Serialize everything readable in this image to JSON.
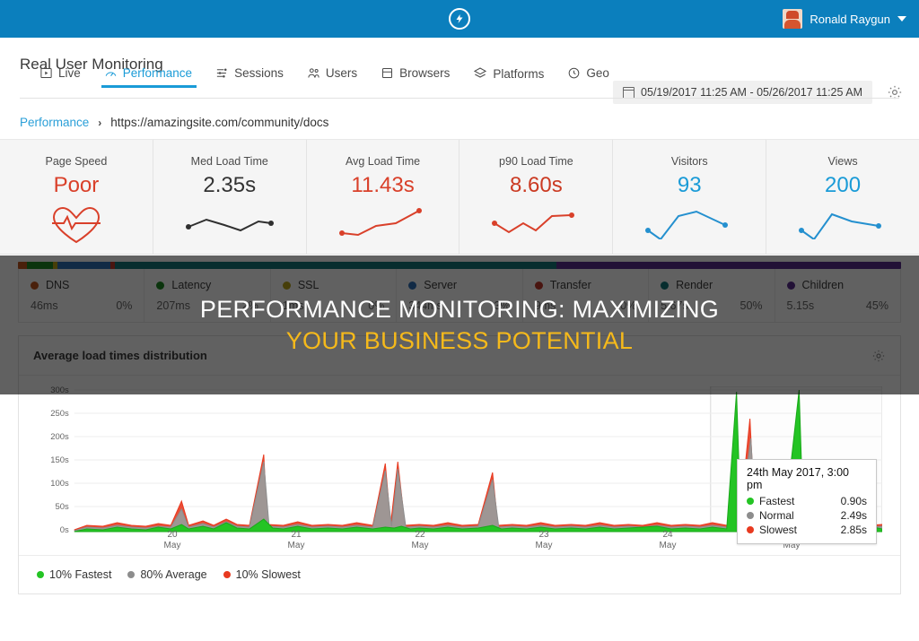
{
  "topbar": {
    "logo_icon": "lightning-bolt-icon",
    "user_name": "Ronald Raygun",
    "caret_icon": "chevron-down-icon"
  },
  "header": {
    "title": "Real User Monitoring",
    "date_range": "05/19/2017 11:25 AM - 05/26/2017 11:25 AM",
    "calendar_icon": "calendar-icon",
    "settings_icon": "gear-icon"
  },
  "nav": {
    "items": [
      {
        "label": "Live",
        "icon": "play-box-icon",
        "active": false
      },
      {
        "label": "Performance",
        "icon": "speedometer-icon",
        "active": true
      },
      {
        "label": "Sessions",
        "icon": "sessions-list-icon",
        "active": false
      },
      {
        "label": "Users",
        "icon": "users-icon",
        "active": false
      },
      {
        "label": "Browsers",
        "icon": "browser-window-icon",
        "active": false
      },
      {
        "label": "Platforms",
        "icon": "layers-icon",
        "active": false
      },
      {
        "label": "Geo",
        "icon": "globe-clock-icon",
        "active": false
      }
    ]
  },
  "breadcrumb": {
    "root": "Performance",
    "separator": "›",
    "current": "https://amazingsite.com/community/docs"
  },
  "metrics": [
    {
      "label": "Page Speed",
      "value": "Poor",
      "color": "#d9402a",
      "spark": "heart-pulse-icon"
    },
    {
      "label": "Med Load Time",
      "value": "2.35s",
      "color": "#333333",
      "spark": "sparkline-dark"
    },
    {
      "label": "Avg Load Time",
      "value": "11.43s",
      "color": "#d9402a",
      "spark": "sparkline-red"
    },
    {
      "label": "p90 Load Time",
      "value": "8.60s",
      "color": "#cb3a22",
      "spark": "sparkline-red"
    },
    {
      "label": "Visitors",
      "value": "93",
      "color": "#1a9bd7",
      "spark": "sparkline-blue"
    },
    {
      "label": "Views",
      "value": "200",
      "color": "#1a9bd7",
      "spark": "sparkline-blue"
    }
  ],
  "breakdown": {
    "segments": [
      {
        "name": "DNS",
        "color": "#c1541f",
        "pct_width": 1
      },
      {
        "name": "Latency",
        "color": "#1e8a24",
        "pct_width": 3
      },
      {
        "name": "SSL",
        "color": "#b8a31a",
        "pct_width": 0.4
      },
      {
        "name": "Server",
        "color": "#2d6fb5",
        "pct_width": 6
      },
      {
        "name": "Transfer",
        "color": "#c0392b",
        "pct_width": 0.4
      },
      {
        "name": "Render",
        "color": "#13767a",
        "pct_width": 50
      },
      {
        "name": "Children",
        "color": "#5b2d8e",
        "pct_width": 39
      }
    ],
    "items": [
      {
        "name": "DNS",
        "dot": "#c1541f",
        "value": "46ms",
        "pct": "0%"
      },
      {
        "name": "Latency",
        "dot": "#1e8a24",
        "value": "207ms",
        "pct": "2%"
      },
      {
        "name": "SSL",
        "dot": "#b8a31a",
        "value": "1ms",
        "pct": "0%"
      },
      {
        "name": "Server",
        "dot": "#2d6fb5",
        "value": "344ms",
        "pct": "3%"
      },
      {
        "name": "Transfer",
        "dot": "#c0392b",
        "value": "9ms",
        "pct": "0%"
      },
      {
        "name": "Render",
        "dot": "#13767a",
        "value": "5.67s",
        "pct": "50%"
      },
      {
        "name": "Children",
        "dot": "#5b2d8e",
        "value": "5.15s",
        "pct": "45%"
      }
    ]
  },
  "panel": {
    "title": "Average load times distribution",
    "settings_icon": "gear-icon"
  },
  "tooltip": {
    "title": "24th May 2017, 3:00 pm",
    "rows": [
      {
        "name": "Fastest",
        "value": "0.90s",
        "color": "#24c424"
      },
      {
        "name": "Normal",
        "value": "2.49s",
        "color": "#8d8d8d"
      },
      {
        "name": "Slowest",
        "value": "2.85s",
        "color": "#e83a20"
      }
    ]
  },
  "legend": [
    {
      "label": "10% Fastest",
      "color": "#24c424"
    },
    {
      "label": "80% Average",
      "color": "#8d8d8d"
    },
    {
      "label": "10% Slowest",
      "color": "#e83a20"
    }
  ],
  "overlay": {
    "line1": "PERFORMANCE MONITORING: MAXIMIZING",
    "line2": "YOUR BUSINESS POTENTIAL"
  },
  "chart_data": {
    "type": "area",
    "title": "Average load times distribution",
    "xlabel": "",
    "ylabel": "",
    "ylim": [
      0,
      300
    ],
    "yticks": [
      "0s",
      "50s",
      "100s",
      "150s",
      "200s",
      "250s",
      "300s"
    ],
    "ytick_values": [
      0,
      50,
      100,
      150,
      200,
      250,
      300
    ],
    "xticks": [
      "20\nMay",
      "21\nMay",
      "22\nMay",
      "23\nMay",
      "24\nMay",
      "25\nMay"
    ],
    "xtick_labels": [
      "20 May",
      "21 May",
      "22 May",
      "23 May",
      "24 May",
      "25 May"
    ],
    "grid": true,
    "legend_position": "bottom-left",
    "series": [
      {
        "name": "10% Fastest",
        "color": "#24c424",
        "values": [
          4,
          6,
          5,
          8,
          6,
          5,
          7,
          6,
          5,
          12,
          9,
          6,
          5,
          7,
          18,
          8,
          6,
          5,
          7,
          20,
          9,
          6,
          5,
          7,
          6,
          5,
          8,
          6,
          5,
          7,
          6,
          9,
          6,
          5,
          7,
          6,
          5,
          8,
          6,
          7,
          5,
          6,
          8,
          6,
          5,
          7,
          6,
          5,
          8,
          6,
          7,
          5,
          9,
          6,
          5,
          7,
          6,
          5,
          8,
          6,
          5,
          7,
          9,
          6,
          288,
          6,
          5,
          8,
          286,
          6,
          5,
          7,
          6,
          5,
          8,
          6,
          5,
          7,
          6,
          9
        ]
      },
      {
        "name": "80% Average",
        "color": "#8d8d8d",
        "values": [
          6,
          8,
          7,
          10,
          8,
          7,
          9,
          8,
          7,
          44,
          12,
          8,
          7,
          9,
          22,
          10,
          8,
          7,
          9,
          24,
          12,
          8,
          7,
          9,
          8,
          145,
          10,
          8,
          7,
          9,
          8,
          12,
          8,
          7,
          9,
          8,
          7,
          10,
          8,
          9,
          7,
          118,
          120,
          8,
          7,
          9,
          8,
          7,
          10,
          8,
          9,
          7,
          12,
          8,
          95,
          9,
          8,
          7,
          10,
          8,
          7,
          9,
          12,
          8,
          10,
          8,
          7,
          10,
          9,
          8,
          7,
          9,
          8,
          7,
          10,
          8,
          7,
          9,
          8,
          12
        ]
      },
      {
        "name": "10% Slowest",
        "color": "#e83a20",
        "values": [
          8,
          10,
          9,
          12,
          10,
          9,
          11,
          10,
          9,
          55,
          14,
          10,
          9,
          11,
          26,
          12,
          10,
          9,
          11,
          28,
          14,
          10,
          9,
          11,
          10,
          160,
          12,
          10,
          9,
          11,
          10,
          14,
          10,
          9,
          11,
          10,
          9,
          12,
          10,
          11,
          9,
          130,
          132,
          10,
          9,
          11,
          10,
          9,
          12,
          10,
          11,
          9,
          14,
          10,
          108,
          11,
          10,
          9,
          12,
          10,
          9,
          11,
          14,
          10,
          12,
          10,
          9,
          12,
          11,
          10,
          252,
          11,
          10,
          9,
          12,
          10,
          9,
          11,
          10,
          14
        ]
      }
    ],
    "annotations": [
      {
        "type": "tooltip",
        "label": "24th May 2017, 3:00 pm",
        "fastest": "0.90s",
        "normal": "2.49s",
        "slowest": "2.85s"
      }
    ],
    "plot_band": {
      "from_x_label": "24 May 18:00",
      "to_x_label": "25 May 24:00",
      "color": "#ffffff"
    }
  }
}
